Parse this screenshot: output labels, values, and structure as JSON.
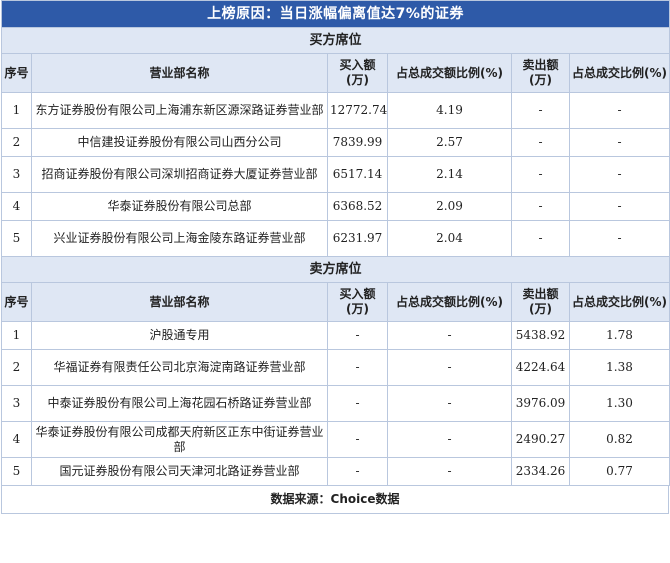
{
  "title": "上榜原因：当日涨幅偏离值达7%的证券",
  "columns": {
    "seq": "序号",
    "name": "营业部名称",
    "buy": "买入额(万)",
    "buy_pct": "占总成交额比例(%)",
    "sell": "卖出额(万)",
    "sell_pct": "占总成交比例(%)"
  },
  "buy_section": {
    "label": "买方席位",
    "rows": [
      {
        "seq": "1",
        "name": "东方证券股份有限公司上海浦东新区源深路证券营业部",
        "buy": "12772.74",
        "buy_pct": "4.19",
        "sell": "-",
        "sell_pct": "-"
      },
      {
        "seq": "2",
        "name": "中信建投证券股份有限公司山西分公司",
        "buy": "7839.99",
        "buy_pct": "2.57",
        "sell": "-",
        "sell_pct": "-"
      },
      {
        "seq": "3",
        "name": "招商证券股份有限公司深圳招商证券大厦证券营业部",
        "buy": "6517.14",
        "buy_pct": "2.14",
        "sell": "-",
        "sell_pct": "-"
      },
      {
        "seq": "4",
        "name": "华泰证券股份有限公司总部",
        "buy": "6368.52",
        "buy_pct": "2.09",
        "sell": "-",
        "sell_pct": "-"
      },
      {
        "seq": "5",
        "name": "兴业证券股份有限公司上海金陵东路证券营业部",
        "buy": "6231.97",
        "buy_pct": "2.04",
        "sell": "-",
        "sell_pct": "-"
      }
    ]
  },
  "sell_section": {
    "label": "卖方席位",
    "rows": [
      {
        "seq": "1",
        "name": "沪股通专用",
        "buy": "-",
        "buy_pct": "-",
        "sell": "5438.92",
        "sell_pct": "1.78"
      },
      {
        "seq": "2",
        "name": "华福证券有限责任公司北京海淀南路证券营业部",
        "buy": "-",
        "buy_pct": "-",
        "sell": "4224.64",
        "sell_pct": "1.38"
      },
      {
        "seq": "3",
        "name": "中泰证券股份有限公司上海花园石桥路证券营业部",
        "buy": "-",
        "buy_pct": "-",
        "sell": "3976.09",
        "sell_pct": "1.30"
      },
      {
        "seq": "4",
        "name": "华泰证券股份有限公司成都天府新区正东中街证券营业部",
        "buy": "-",
        "buy_pct": "-",
        "sell": "2490.27",
        "sell_pct": "0.82"
      },
      {
        "seq": "5",
        "name": "国元证券股份有限公司天津河北路证券营业部",
        "buy": "-",
        "buy_pct": "-",
        "sell": "2334.26",
        "sell_pct": "0.77"
      }
    ]
  },
  "source": "数据来源：Choice数据"
}
